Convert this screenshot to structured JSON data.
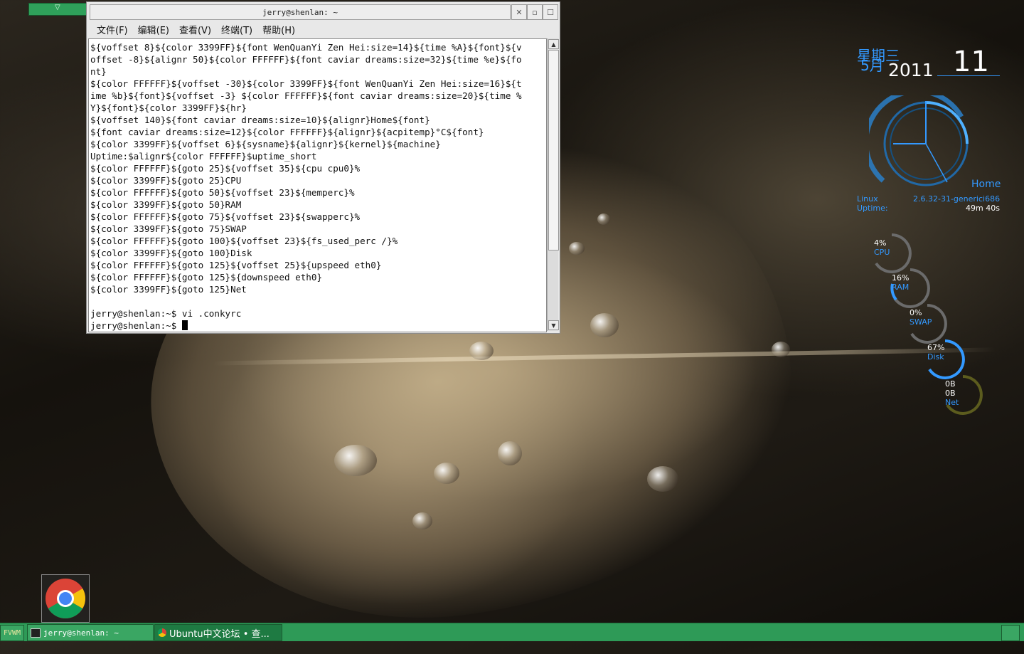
{
  "pager": {
    "arrow": "▽"
  },
  "terminal": {
    "title": "jerry@shenlan: ~",
    "menu": [
      "文件(F)",
      "编辑(E)",
      "查看(V)",
      "终端(T)",
      "帮助(H)"
    ],
    "lines": [
      "${voffset 8}${color 3399FF}${font WenQuanYi Zen Hei:size=14}${time %A}${font}${v",
      "offset -8}${alignr 50}${color FFFFFF}${font caviar dreams:size=32}${time %e}${fo",
      "nt}",
      "${color FFFFFF}${voffset -30}${color 3399FF}${font WenQuanYi Zen Hei:size=16}${t",
      "ime %b}${font}${voffset -3} ${color FFFFFF}${font caviar dreams:size=20}${time %",
      "Y}${font}${color 3399FF}${hr}",
      "${voffset 140}${font caviar dreams:size=10}${alignr}Home${font}",
      "${font caviar dreams:size=12}${color FFFFFF}${alignr}${acpitemp}°C${font}",
      "${color 3399FF}${voffset 6}${sysname}${alignr}${kernel}${machine}",
      "Uptime:$alignr${color FFFFFF}$uptime_short",
      "${color FFFFFF}${goto 25}${voffset 35}${cpu cpu0}%",
      "${color 3399FF}${goto 25}CPU",
      "${color FFFFFF}${goto 50}${voffset 23}${memperc}%",
      "${color 3399FF}${goto 50}RAM",
      "${color FFFFFF}${goto 75}${voffset 23}${swapperc}%",
      "${color 3399FF}${goto 75}SWAP",
      "${color FFFFFF}${goto 100}${voffset 23}${fs_used_perc /}%",
      "${color 3399FF}${goto 100}Disk",
      "${color FFFFFF}${goto 125}${voffset 25}${upspeed eth0}",
      "${color FFFFFF}${goto 125}${downspeed eth0}",
      "${color 3399FF}${goto 125}Net",
      "",
      "jerry@shenlan:~$ vi .conkyrc"
    ],
    "prompt": "jerry@shenlan:~$ "
  },
  "conky": {
    "weekday": "星期三",
    "month": "5月",
    "year": "2011",
    "day": "11",
    "home": "Home",
    "sysname": "Linux",
    "kernel": "2.6.32-31-generici686",
    "uptime_label": "Uptime:",
    "uptime": "49m 40s",
    "meters": [
      {
        "value": "4%",
        "label": "CPU",
        "percent": 4
      },
      {
        "value": "16%",
        "label": "RAM",
        "percent": 16
      },
      {
        "value": "0%",
        "label": "SWAP",
        "percent": 0
      },
      {
        "value": "67%",
        "label": "Disk",
        "percent": 67
      }
    ],
    "net_up": "0B",
    "net_down": "0B",
    "net_label": "Net"
  },
  "taskbar": {
    "start": "FVWM",
    "tasks": [
      {
        "label": "jerry@shenlan: ~"
      },
      {
        "label": "Ubuntu中文论坛 • 查..."
      }
    ]
  },
  "colors": {
    "accent": "#3399ff",
    "taskbar": "#2e9a57"
  }
}
